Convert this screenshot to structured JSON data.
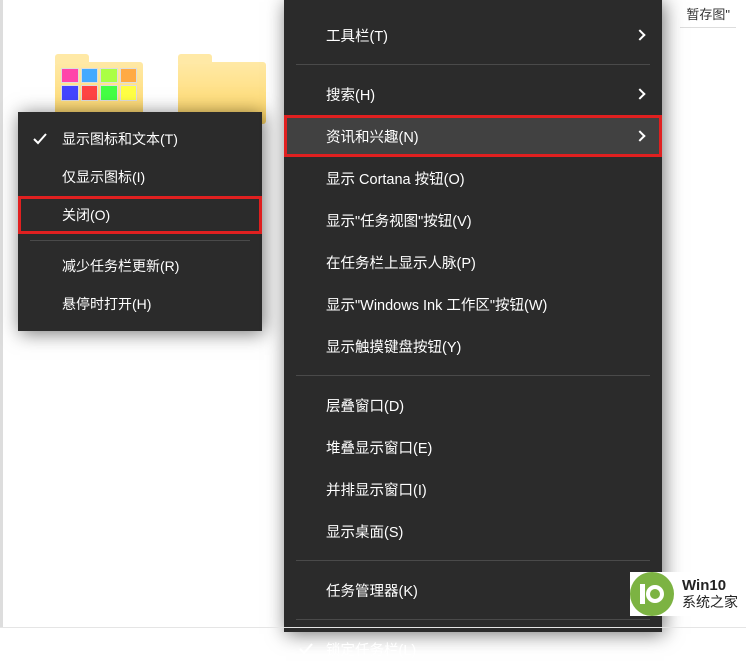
{
  "top_partial": "暂存图\"",
  "submenu": {
    "items": [
      {
        "label": "显示图标和文本(T)",
        "checked": true
      },
      {
        "label": "仅显示图标(I)",
        "checked": false
      },
      {
        "label": "关闭(O)",
        "checked": false,
        "highlighted": true
      }
    ],
    "items2": [
      {
        "label": "减少任务栏更新(R)"
      },
      {
        "label": "悬停时打开(H)"
      }
    ]
  },
  "mainmenu": {
    "group1": [
      {
        "label": "工具栏(T)",
        "submenu": true
      }
    ],
    "group2": [
      {
        "label": "搜索(H)",
        "submenu": true
      },
      {
        "label": "资讯和兴趣(N)",
        "submenu": true,
        "hover": true,
        "highlighted": true
      },
      {
        "label": "显示 Cortana 按钮(O)"
      },
      {
        "label": "显示\"任务视图\"按钮(V)"
      },
      {
        "label": "在任务栏上显示人脉(P)"
      },
      {
        "label": "显示\"Windows Ink 工作区\"按钮(W)"
      },
      {
        "label": "显示触摸键盘按钮(Y)"
      }
    ],
    "group3": [
      {
        "label": "层叠窗口(D)"
      },
      {
        "label": "堆叠显示窗口(E)"
      },
      {
        "label": "并排显示窗口(I)"
      },
      {
        "label": "显示桌面(S)"
      }
    ],
    "group4": [
      {
        "label": "任务管理器(K)"
      }
    ],
    "group5": [
      {
        "label": "锁定任务栏(L)",
        "checked": true
      }
    ]
  },
  "watermark": {
    "line1": "Win10",
    "line2": "系统之家"
  }
}
